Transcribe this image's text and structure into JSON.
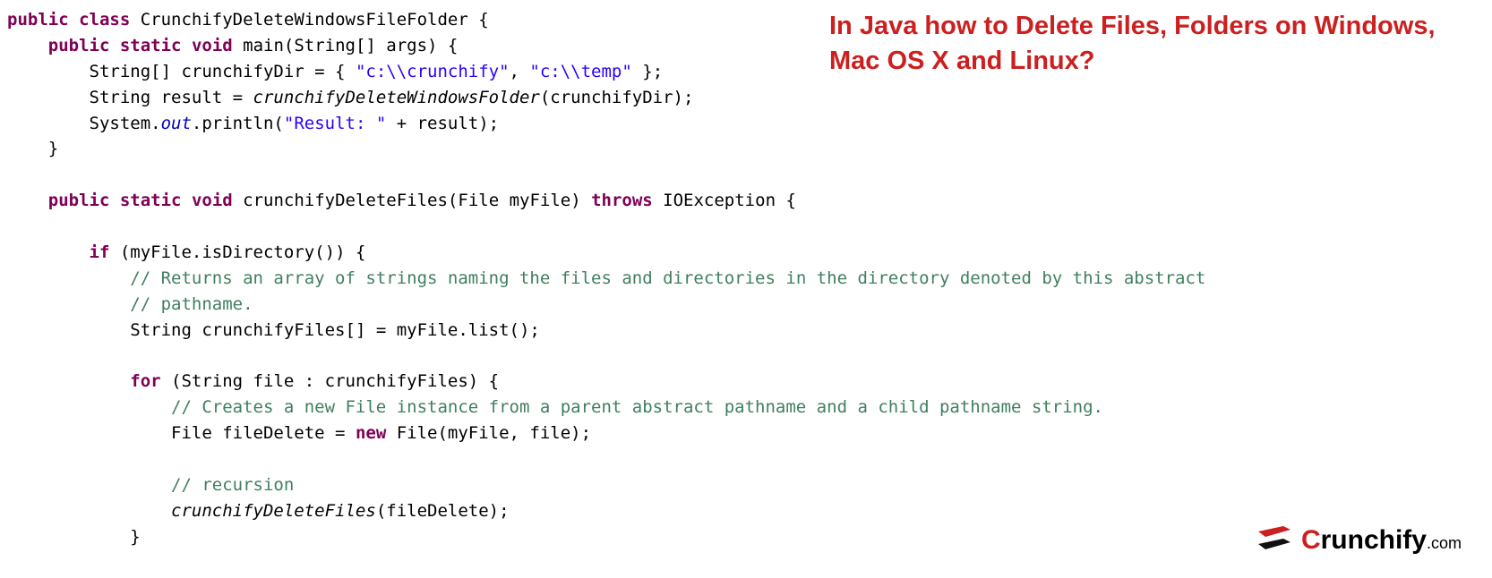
{
  "heading": "In Java how to Delete Files, Folders on Windows, Mac OS X and Linux?",
  "code": {
    "l1": {
      "a": "public",
      "b": " ",
      "c": "class",
      "d": " CrunchifyDeleteWindowsFileFolder {"
    },
    "l2": {
      "a": "public",
      "b": " ",
      "c": "static",
      "d": " ",
      "e": "void",
      "f": " main(String[] args) {"
    },
    "l3": {
      "a": "String[] crunchifyDir = { ",
      "s1": "\"c:\\\\crunchify\"",
      "b": ", ",
      "s2": "\"c:\\\\temp\"",
      "c": " };"
    },
    "l4": {
      "a": "String result = ",
      "m": "crunchifyDeleteWindowsFolder",
      "b": "(crunchifyDir);"
    },
    "l5": {
      "a": "System.",
      "f": "out",
      "b": ".println(",
      "s": "\"Result: \"",
      "c": " + result);"
    },
    "l6": {
      "a": "}"
    },
    "l7": {
      "a": "public",
      "b": " ",
      "c": "static",
      "d": " ",
      "e": "void",
      "f": " crunchifyDeleteFiles(File myFile) ",
      "g": "throws",
      "h": " IOException {"
    },
    "l8": {
      "a": "if",
      "b": " (myFile.isDirectory()) {"
    },
    "l9": {
      "a": "// Returns an array of strings naming the files and directories in the directory denoted by this abstract"
    },
    "l10": {
      "a": "// pathname."
    },
    "l11": {
      "a": "String crunchifyFiles[] = myFile.list();"
    },
    "l12": {
      "a": "for",
      "b": " (String file : crunchifyFiles) {"
    },
    "l13": {
      "a": "// Creates a new File instance from a parent abstract pathname and a child pathname string."
    },
    "l14": {
      "a": "File fileDelete = ",
      "n": "new",
      "b": " File(myFile, file);"
    },
    "l15": {
      "a": "// recursion"
    },
    "l16": {
      "m": "crunchifyDeleteFiles",
      "b": "(fileDelete);"
    },
    "l17": {
      "a": "}"
    }
  },
  "brand": {
    "name": "Crunchify",
    "suffix": ".com"
  },
  "colors": {
    "accent": "#cc1f1f",
    "keyword": "#7f0055",
    "string": "#2a00ff",
    "comment": "#3f7f5f",
    "staticField": "#0000c0"
  }
}
